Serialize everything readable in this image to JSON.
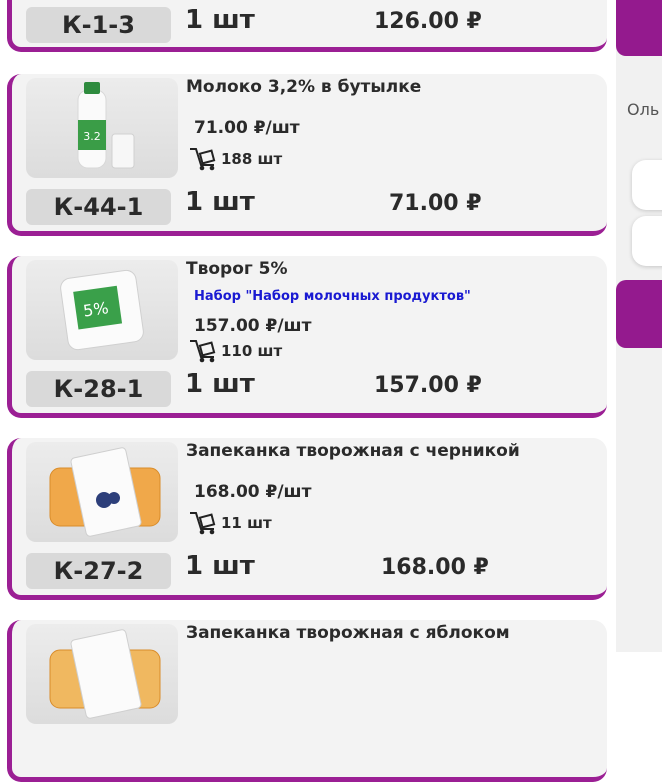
{
  "colors": {
    "accent": "#941a8e",
    "kit_link": "#1a1ad2"
  },
  "sidebar": {
    "label_fragment": "Оль"
  },
  "items": [
    {
      "code": "К-1-3",
      "qty": "1 шт",
      "total": "126.00 ₽"
    },
    {
      "title": "Молоко 3,2% в бутылке",
      "unit_price": "71.00 ₽/шт",
      "stock": "188 шт",
      "code": "К-44-1",
      "qty": "1 шт",
      "total": "71.00 ₽",
      "image_icon": "milk-bottle-image"
    },
    {
      "title": "Творог 5%",
      "kit": "Набор \"Набор молочных продуктов\"",
      "unit_price": "157.00 ₽/шт",
      "stock": "110 шт",
      "code": "К-28-1",
      "qty": "1 шт",
      "total": "157.00 ₽",
      "image_icon": "cottage-cheese-image"
    },
    {
      "title": "Запеканка творожная с черникой",
      "unit_price": "168.00 ₽/шт",
      "stock": "11 шт",
      "code": "К-27-2",
      "qty": "1 шт",
      "total": "168.00 ₽",
      "image_icon": "casserole-blueberry-image"
    },
    {
      "title": "Запеканка творожная с яблоком",
      "image_icon": "casserole-apple-image"
    }
  ]
}
